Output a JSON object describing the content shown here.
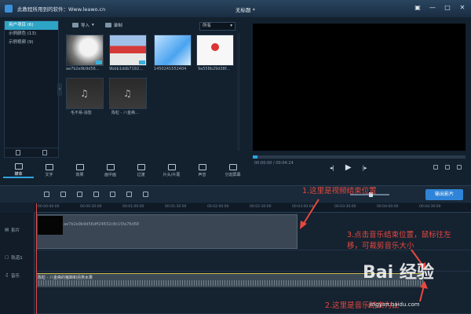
{
  "window": {
    "app_title": "此教程所用到的软件：Www.leawo.cn",
    "doc_title": "无标题 *",
    "buttons": [
      "▣",
      "—",
      "□",
      "✕"
    ]
  },
  "sidebar": {
    "items": [
      {
        "label": "用户项目 (6)",
        "active": true
      },
      {
        "label": "示例颜色 (13)",
        "active": false
      },
      {
        "label": "示例视频 (9)",
        "active": false
      }
    ]
  },
  "library": {
    "import_label": "导入",
    "record_label": "录制",
    "sort_value": "所有",
    "thumbs": [
      {
        "caption": "ae7b2e9b9d56..."
      },
      {
        "caption": "9bbb1ddb7192..."
      },
      {
        "caption": "1450241552404"
      },
      {
        "caption": "9a558b29d38f..."
      },
      {
        "caption": "毛不易-消愁"
      },
      {
        "caption": "陈粒 - 八金斋..."
      }
    ]
  },
  "preview": {
    "time": "00:00:00 / 00:04:24"
  },
  "functions": [
    {
      "label": "媒体",
      "active": true
    },
    {
      "label": "文字",
      "active": false
    },
    {
      "label": "效果",
      "active": false
    },
    {
      "label": "画中画",
      "active": false
    },
    {
      "label": "过渡",
      "active": false
    },
    {
      "label": "片头/片尾",
      "active": false
    },
    {
      "label": "声音",
      "active": false
    },
    {
      "label": "分割屏幕",
      "active": false
    }
  ],
  "timeline": {
    "export_label": "输出影片",
    "ticks": [
      "00:00:00:00",
      "00:00:30:00",
      "00:01:00:00",
      "00:01:30:00",
      "00:02:00:00",
      "00:02:30:00",
      "00:03:00:00",
      "00:03:30:00",
      "00:04:00:00",
      "00:04:30:00"
    ],
    "tracks": {
      "video": "影片",
      "overlay": "轨道1",
      "music": "音乐"
    },
    "video_clip": "ae7b2e9b9d56dff24832c8c15fa76d58",
    "audio_clip": "陈粒 - 八金斋的猪蹄和另类水果"
  },
  "annotations": {
    "a1": "1.这里是视频结束位置",
    "a2": "2.这里是音乐结束为止",
    "a3": "3.点击音乐结束位置，鼠标往左移，可裁剪音乐大小"
  },
  "watermark": {
    "logo": "Bai 经验",
    "url": "jingyan.baidu.com"
  }
}
